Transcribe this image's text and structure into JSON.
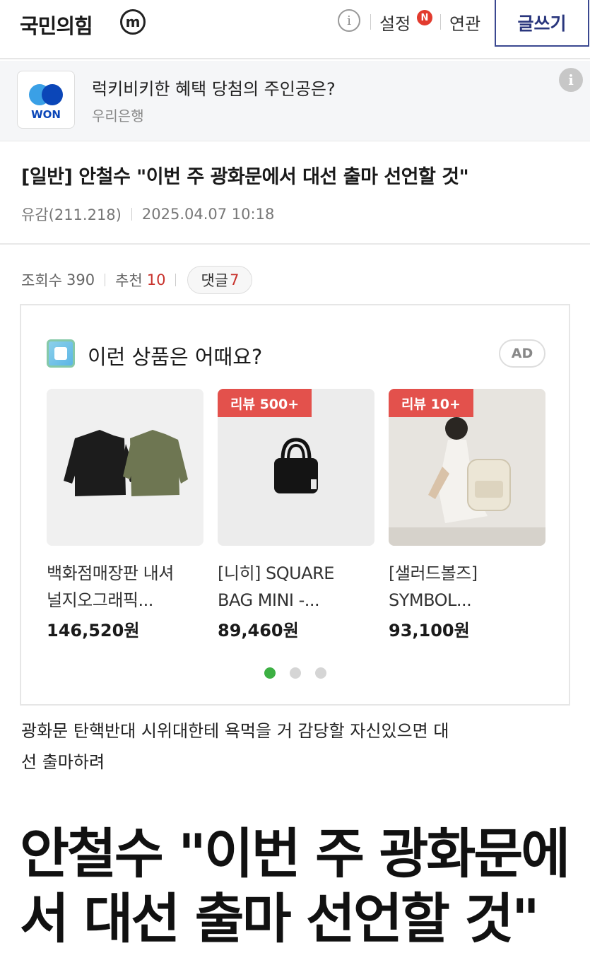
{
  "header": {
    "gallery_name": "국민의힘",
    "minor_badge": "m",
    "info_label": "i",
    "settings_label": "설정",
    "new_badge": "N",
    "related_label": "연관",
    "write_label": "글쓰기"
  },
  "banner_ad": {
    "logo_text": "WON",
    "title": "럭키비키한 혜택 당첨의 주인공은?",
    "advertiser": "우리은행",
    "info_label": "i"
  },
  "post": {
    "title": "[일반] 안철수 \"이번 주 광화문에서 대선 출마 선언할 것\"",
    "author": "유감(211.218)",
    "datetime": "2025.04.07 10:18",
    "views_label": "조회수",
    "views_value": "390",
    "recommend_label": "추천",
    "recommend_value": "10",
    "comments_label": "댓글",
    "comments_value": "7"
  },
  "product_ad": {
    "heading": "이런 상품은 어때요?",
    "ad_tag": "AD",
    "products": [
      {
        "name_line1": "백화점매장판 내셔",
        "name_line2": "널지오그래픽...",
        "price": "146,520원",
        "badge": ""
      },
      {
        "name_line1": "[니히] SQUARE",
        "name_line2": "BAG MINI -...",
        "price": "89,460원",
        "badge": "리뷰 500+"
      },
      {
        "name_line1": "[샐러드볼즈]",
        "name_line2": "SYMBOL...",
        "price": "93,100원",
        "badge": "리뷰 10+"
      }
    ],
    "active_page": 1,
    "page_count": 3
  },
  "body": {
    "text_line1": "광화문 탄핵반대 시위대한테 욕먹을 거 감당할 자신있으면 대",
    "text_line2": "선 출마하려",
    "headline_line1": "안철수 \"이번 주 광화문에",
    "headline_line2": "서 대선 출마 선언할 것\""
  },
  "colors": {
    "accent_red": "#c8322c",
    "write_border": "#3b4890",
    "badge_red": "#e3514c",
    "dot_active": "#3cb043"
  }
}
